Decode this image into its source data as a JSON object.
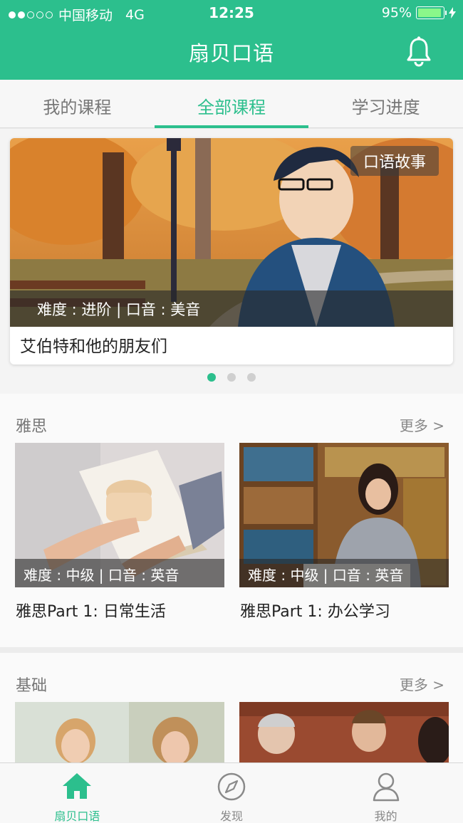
{
  "status_bar": {
    "carrier": "中国移动",
    "network": "4G",
    "time": "12:25",
    "battery_percent": "95%",
    "battery_level": 0.95,
    "signal_dots_filled": 2,
    "signal_dots_total": 5
  },
  "nav": {
    "title": "扇贝口语",
    "bell_icon": "bell-icon"
  },
  "tabs": [
    {
      "label": "我的课程",
      "active": false
    },
    {
      "label": "全部课程",
      "active": true
    },
    {
      "label": "学习进度",
      "active": false
    }
  ],
  "banner": {
    "tag": "口语故事",
    "meta": "难度 : 进阶  |  口音 : 美音",
    "title": "艾伯特和他的朋友们",
    "pages": 3,
    "active_page": 1
  },
  "sections": [
    {
      "heading": "雅思",
      "more": "更多 >",
      "items": [
        {
          "meta": "难度 : 中级  |  口音 : 英音",
          "title": "雅思Part 1:  日常生活"
        },
        {
          "meta": "难度 : 中级  |  口音 : 英音",
          "title": "雅思Part 1:  办公学习"
        }
      ]
    },
    {
      "heading": "基础",
      "more": "更多 >"
    }
  ],
  "bottom_nav": [
    {
      "label": "扇贝口语",
      "icon": "home-icon",
      "active": true
    },
    {
      "label": "发现",
      "icon": "compass-icon",
      "active": false
    },
    {
      "label": "我的",
      "icon": "person-icon",
      "active": false
    }
  ],
  "colors": {
    "accent": "#2cbf8d",
    "text": "#222222",
    "muted": "#777777"
  }
}
